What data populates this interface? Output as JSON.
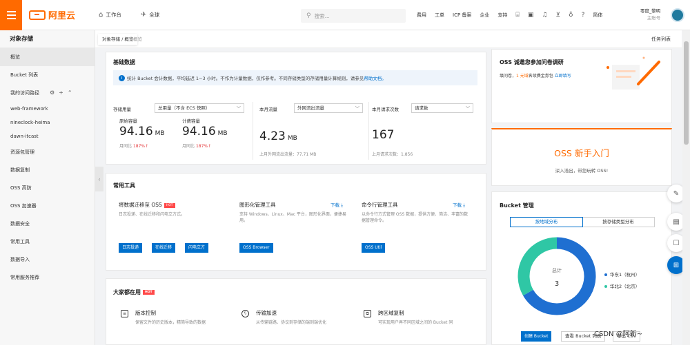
{
  "topbar": {
    "brand": "阿里云",
    "workbench": "工作台",
    "global": "全球",
    "search_placeholder": "搜索...",
    "links": [
      "费用",
      "工单",
      "ICP 备案",
      "企业",
      "支持"
    ],
    "lang": "简体",
    "user_name": "零度_黎明",
    "user_role": "主账号"
  },
  "sidebar": {
    "title": "对象存储",
    "items": [
      "概览",
      "Bucket 列表",
      "我的访问路径",
      "web-framework",
      "nineclock-heima",
      "dawn-itcast",
      "资源包管理",
      "数据复制",
      "OSS 高防",
      "OSS 加速器",
      "数据安全",
      "常用工具",
      "数据导入",
      "常用服务推荐"
    ]
  },
  "breadcrumb": {
    "tip": "对象存储 / 概览",
    "current": "概览",
    "right_link": "任务列表"
  },
  "basic": {
    "title": "基础数据",
    "info_text": "统计 Bucket 会计数据，平均延迟 1~3 小时。不作为计量数据，仅作参考。不同存储类型的存储用量计算规则，请参见",
    "info_link": "帮助文档。",
    "storage_label": "存储用量",
    "storage_select": "总用量（不含 ECS 快照）",
    "original_label": "原始容量",
    "original_value": "94.16",
    "original_unit": "MB",
    "original_mom": "月同比",
    "original_pct": "187%↑",
    "billing_label": "计费容量",
    "billing_value": "94.16",
    "billing_unit": "MB",
    "billing_mom": "月同比",
    "billing_pct": "187%↑",
    "traffic_label": "本月流量",
    "traffic_select": "外网流出流量",
    "traffic_value": "4.23",
    "traffic_unit": "MB",
    "traffic_last": "上月外网流出流量：77.71 MB",
    "req_label": "本月请求次数",
    "req_select": "请求数",
    "req_value": "167",
    "req_last": "上月请求次数：1,856"
  },
  "tools": {
    "title": "常用工具",
    "t1_title": "将数据迁移至 OSS",
    "t1_desc": "日志投递、在线迁移和闪电立方式。",
    "t1_btns": [
      "日志投递",
      "在线迁移",
      "闪电立方"
    ],
    "t2_title": "图形化管理工具",
    "t2_desc": "支持 Windows、Linux、Mac 平台，图形化界面，便捷易用。",
    "t2_btn": "OSS Browser",
    "t3_title": "命令行管理工具",
    "t3_desc": "以命令行方式管理 OSS 数据，提供方便、简洁、丰富的数据管理命令。",
    "t3_btn": "OSS Util",
    "download": "下载",
    "hot": "HOT"
  },
  "popular": {
    "title": "大家都在用",
    "hot": "HOT",
    "i1_title": "版本控制",
    "i1_desc": "保留文件的历史版本，精简导致的数据",
    "i2_title": "传输加速",
    "i2_desc": "从传输链路、协议到存储的端到端优化",
    "i3_title": "跨区域复制",
    "i3_desc": "可实现用户再不同区域之间的 Bucket 同"
  },
  "survey": {
    "title": "OSS 诚邀您参加问卷调研",
    "desc_a": "填问卷，",
    "desc_b": "1 元域",
    "desc_c": "名续费金券包",
    "link": "立即填写"
  },
  "guide": {
    "title": "OSS 新手入门",
    "desc": "深入浅出，带您玩转 OSS!"
  },
  "bucket": {
    "title": "Bucket 管理",
    "tabs": [
      "按地域分布",
      "按存储类型分布"
    ],
    "total_label": "总计",
    "total_value": "3",
    "legend": [
      {
        "name": "华东1（杭州）",
        "color": "#1f6fd1",
        "count": 2
      },
      {
        "name": "华北2（北京）",
        "color": "#2fc7a5",
        "count": 1
      }
    ],
    "create": "创建 Bucket",
    "list": "查看 Bucket 列表",
    "export": "导出 CSV"
  },
  "watermark": "CSDN @阿新~",
  "colors": {
    "accent": "#ff6a00",
    "primary": "#0070cc"
  }
}
